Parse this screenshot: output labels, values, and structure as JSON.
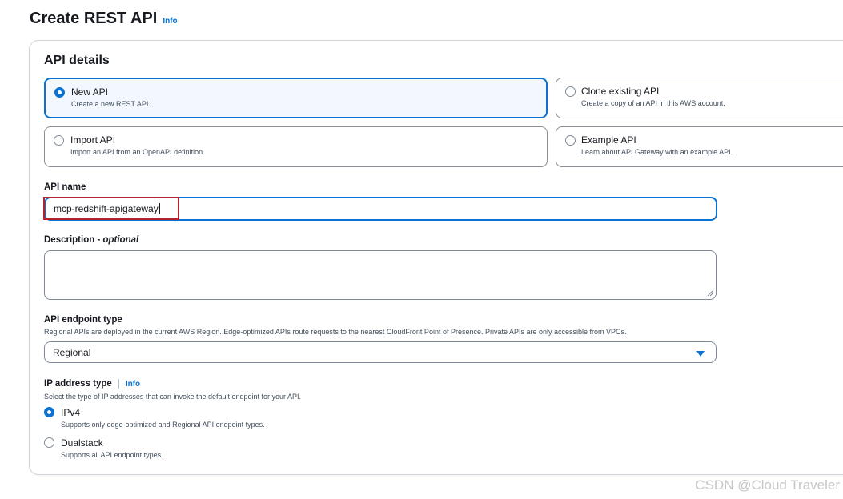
{
  "page": {
    "title": "Create REST API",
    "info_label": "Info"
  },
  "panel": {
    "title": "API details"
  },
  "api_types": [
    {
      "title": "New API",
      "desc": "Create a new REST API.",
      "selected": true
    },
    {
      "title": "Clone existing API",
      "desc": "Create a copy of an API in this AWS account.",
      "selected": false
    },
    {
      "title": "Import API",
      "desc": "Import an API from an OpenAPI definition.",
      "selected": false
    },
    {
      "title": "Example API",
      "desc": "Learn about API Gateway with an example API.",
      "selected": false
    }
  ],
  "api_name": {
    "label": "API name",
    "value": "mcp-redshift-apigateway"
  },
  "description": {
    "label": "Description",
    "optional": "optional",
    "separator": " - ",
    "value": ""
  },
  "endpoint_type": {
    "label": "API endpoint type",
    "desc": "Regional APIs are deployed in the current AWS Region. Edge-optimized APIs route requests to the nearest CloudFront Point of Presence. Private APIs are only accessible from VPCs.",
    "value": "Regional"
  },
  "ip_address_type": {
    "label": "IP address type",
    "info_label": "Info",
    "desc": "Select the type of IP addresses that can invoke the default endpoint for your API.",
    "options": [
      {
        "title": "IPv4",
        "desc": "Supports only edge-optimized and Regional API endpoint types.",
        "selected": true
      },
      {
        "title": "Dualstack",
        "desc": "Supports all API endpoint types.",
        "selected": false
      }
    ]
  },
  "watermark": "CSDN @Cloud Traveler",
  "colors": {
    "accent": "#0972d3",
    "highlight": "#b0232f",
    "text": "#16191f"
  }
}
